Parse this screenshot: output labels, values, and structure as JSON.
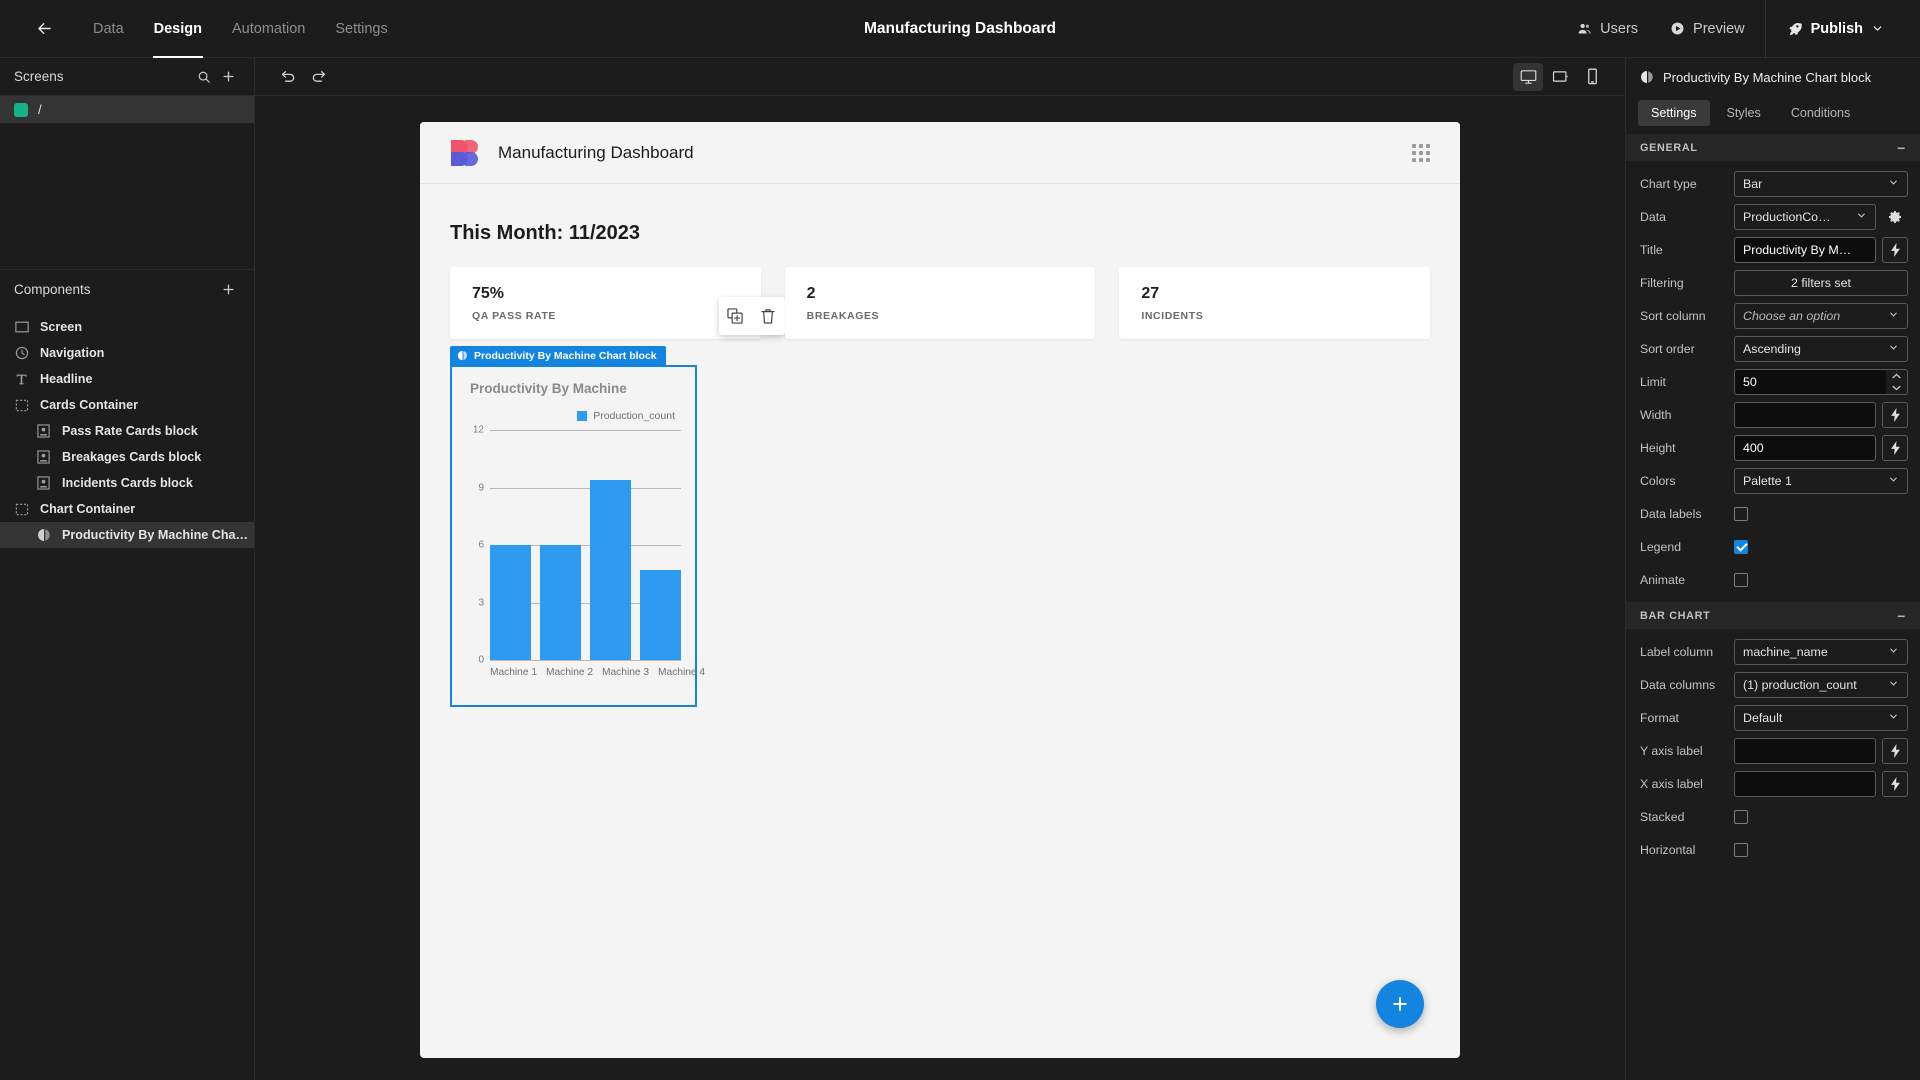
{
  "topbar": {
    "back_icon": "arrow-left-icon",
    "nav": [
      {
        "label": "Data",
        "active": false
      },
      {
        "label": "Design",
        "active": true
      },
      {
        "label": "Automation",
        "active": false
      },
      {
        "label": "Settings",
        "active": false
      }
    ],
    "title": "Manufacturing Dashboard",
    "users_label": "Users",
    "preview_label": "Preview",
    "publish_label": "Publish"
  },
  "sidebar": {
    "screens_title": "Screens",
    "search_icon": "search-icon",
    "add_icon": "plus-icon",
    "screens": [
      {
        "label": "/",
        "color": "#14b38b",
        "selected": true
      }
    ],
    "components_title": "Components",
    "components_add_icon": "plus-icon",
    "components": [
      {
        "label": "Screen",
        "icon": "screen-icon",
        "indent": false,
        "selected": false
      },
      {
        "label": "Navigation",
        "icon": "navigation-icon",
        "indent": false,
        "selected": false
      },
      {
        "label": "Headline",
        "icon": "text-icon",
        "indent": false,
        "selected": false
      },
      {
        "label": "Cards Container",
        "icon": "container-icon",
        "indent": false,
        "selected": false
      },
      {
        "label": "Pass Rate Cards block",
        "icon": "card-icon",
        "indent": true,
        "selected": false
      },
      {
        "label": "Breakages Cards block",
        "icon": "card-icon",
        "indent": true,
        "selected": false
      },
      {
        "label": "Incidents Cards block",
        "icon": "card-icon",
        "indent": true,
        "selected": false
      },
      {
        "label": "Chart Container",
        "icon": "container-icon",
        "indent": false,
        "selected": false
      },
      {
        "label": "Productivity By Machine Cha…",
        "icon": "chart-icon",
        "indent": true,
        "selected": true
      }
    ]
  },
  "canvas_toolbar": {
    "undo_icon": "undo-icon",
    "redo_icon": "redo-icon",
    "devices": [
      {
        "name": "desktop-icon",
        "active": true
      },
      {
        "name": "tablet-icon",
        "active": false
      },
      {
        "name": "mobile-icon",
        "active": false
      }
    ]
  },
  "canvas": {
    "site_title": "Manufacturing Dashboard",
    "logo_icon": "budibase-logo",
    "grid_icon": "grid-dots-icon",
    "headline": "This Month: 11/2023",
    "cards": [
      {
        "value": "75%",
        "label": "QA PASS RATE",
        "has_tools": true
      },
      {
        "value": "2",
        "label": "BREAKAGES",
        "has_tools": false
      },
      {
        "value": "27",
        "label": "INCIDENTS",
        "has_tools": false
      }
    ],
    "hover_tools": {
      "duplicate_icon": "duplicate-icon",
      "delete_icon": "trash-icon"
    },
    "block_tab_label": "Productivity By Machine Chart block",
    "block_tab_icon": "chart-icon",
    "fab_label": "+",
    "accent": "#1384e0"
  },
  "chart_data": {
    "type": "bar",
    "title": "Productivity By Machine",
    "categories": [
      "Machine 1",
      "Machine 2",
      "Machine 3",
      "Machine 4"
    ],
    "series": [
      {
        "name": "Production_count",
        "values": [
          6.5,
          6.5,
          10.2,
          5.1
        ],
        "color": "#2e9bf0"
      }
    ],
    "yticks": [
      12,
      9,
      6,
      3,
      0
    ],
    "ylim": [
      0,
      13
    ],
    "xlabel": "",
    "ylabel": "",
    "legend": [
      "Production_count"
    ],
    "legend_position": "top-right",
    "grid": true
  },
  "rightpanel": {
    "header_title": "Productivity By Machine Chart block",
    "header_icon": "chart-icon",
    "tabs": [
      {
        "label": "Settings",
        "active": true
      },
      {
        "label": "Styles",
        "active": false
      },
      {
        "label": "Conditions",
        "active": false
      }
    ],
    "general": {
      "section_title": "GENERAL",
      "collapse_icon": "minus-icon",
      "rows": [
        {
          "label": "Chart type",
          "kind": "select",
          "value": "Bar"
        },
        {
          "label": "Data",
          "kind": "select-gear",
          "value": "ProductionCo…",
          "gear_icon": "gear-icon"
        },
        {
          "label": "Title",
          "kind": "text-bolt",
          "value": "Productivity By M…",
          "bolt_icon": "bolt-icon"
        },
        {
          "label": "Filtering",
          "kind": "button",
          "value": "2 filters set"
        },
        {
          "label": "Sort column",
          "kind": "select-placeholder",
          "value": "Choose an option"
        },
        {
          "label": "Sort order",
          "kind": "select",
          "value": "Ascending"
        },
        {
          "label": "Limit",
          "kind": "number",
          "value": "50"
        },
        {
          "label": "Width",
          "kind": "empty-bolt",
          "value": "",
          "bolt_icon": "bolt-icon"
        },
        {
          "label": "Height",
          "kind": "text-bolt",
          "value": "400",
          "bolt_icon": "bolt-icon"
        },
        {
          "label": "Colors",
          "kind": "select",
          "value": "Palette 1"
        },
        {
          "label": "Data labels",
          "kind": "checkbox",
          "checked": false
        },
        {
          "label": "Legend",
          "kind": "checkbox",
          "checked": true
        },
        {
          "label": "Animate",
          "kind": "checkbox",
          "checked": false
        }
      ]
    },
    "barchart": {
      "section_title": "BAR CHART",
      "collapse_icon": "minus-icon",
      "rows": [
        {
          "label": "Label column",
          "kind": "select",
          "value": "machine_name"
        },
        {
          "label": "Data columns",
          "kind": "select",
          "value": "(1) production_count"
        },
        {
          "label": "Format",
          "kind": "select",
          "value": "Default"
        },
        {
          "label": "Y axis label",
          "kind": "empty-bolt",
          "value": "",
          "bolt_icon": "bolt-icon"
        },
        {
          "label": "X axis label",
          "kind": "empty-bolt",
          "value": "",
          "bolt_icon": "bolt-icon"
        },
        {
          "label": "Stacked",
          "kind": "checkbox",
          "checked": false
        },
        {
          "label": "Horizontal",
          "kind": "checkbox",
          "checked": false
        }
      ]
    }
  }
}
